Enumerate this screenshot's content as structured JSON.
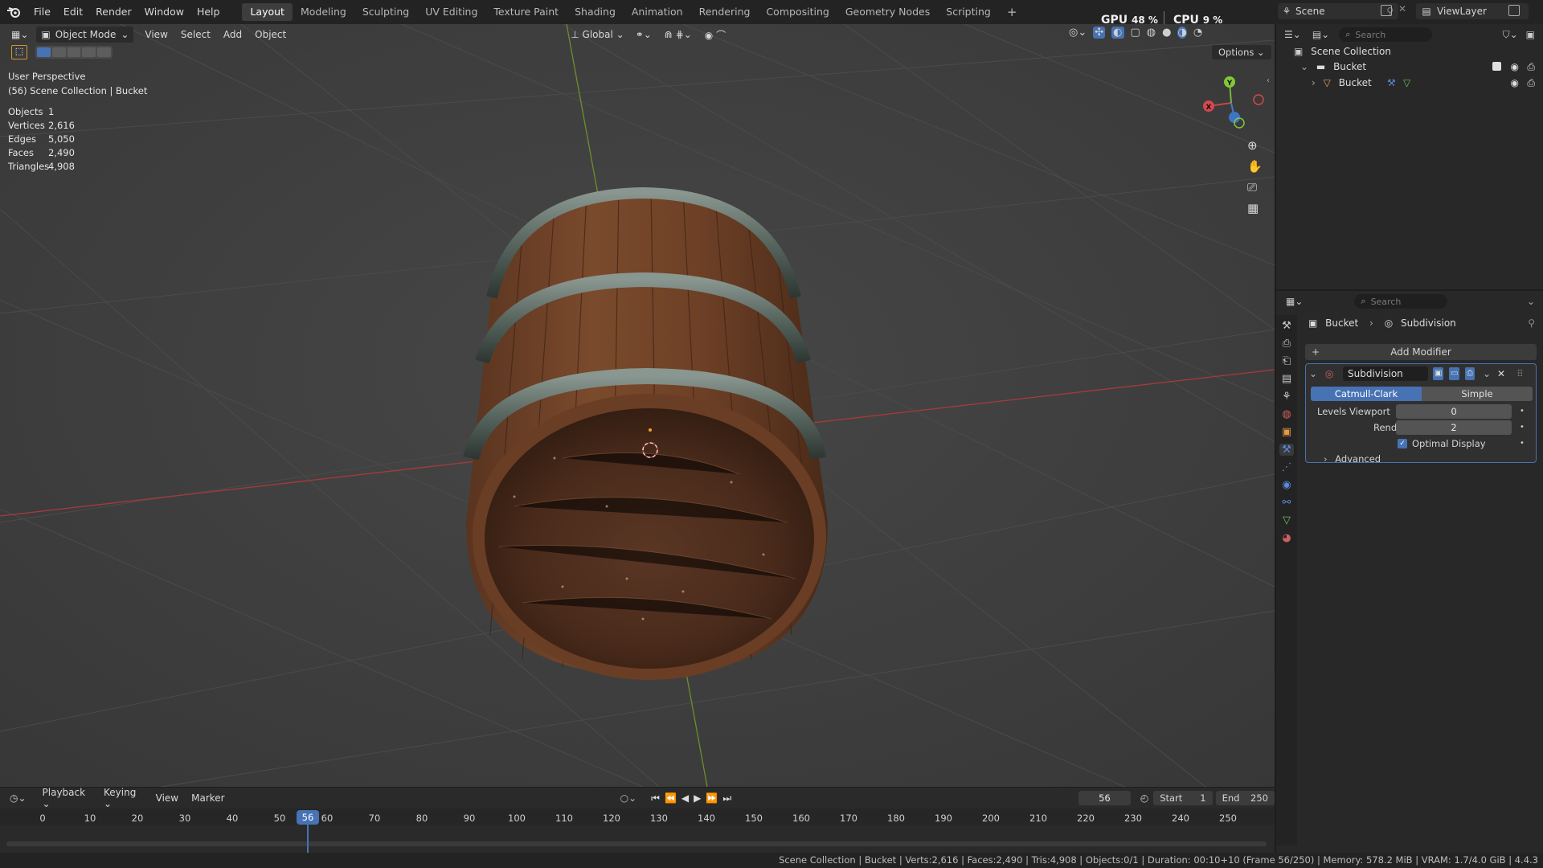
{
  "topbar": {
    "menus": [
      "File",
      "Edit",
      "Render",
      "Window",
      "Help"
    ],
    "workspaces": [
      "Layout",
      "Modeling",
      "Sculpting",
      "UV Editing",
      "Texture Paint",
      "Shading",
      "Animation",
      "Rendering",
      "Compositing",
      "Geometry Nodes",
      "Scripting"
    ],
    "active_workspace": "Layout",
    "gpu_label": "GPU",
    "gpu_value": "48 %",
    "cpu_label": "CPU",
    "cpu_value": "9 %",
    "scene": "Scene",
    "view_layer": "ViewLayer"
  },
  "viewport_header": {
    "mode": "Object Mode",
    "menus": [
      "View",
      "Select",
      "Add",
      "Object"
    ],
    "transform_orientation": "Global",
    "options": "Options"
  },
  "overlay": {
    "perspective": "User Perspective",
    "collection": "(56) Scene Collection | Bucket",
    "stats": [
      {
        "label": "Objects",
        "value": "1"
      },
      {
        "label": "Vertices",
        "value": "2,616"
      },
      {
        "label": "Edges",
        "value": "5,050"
      },
      {
        "label": "Faces",
        "value": "2,490"
      },
      {
        "label": "Triangles",
        "value": "4,908"
      }
    ]
  },
  "gizmo": {
    "x": "X",
    "y": "Y"
  },
  "outliner": {
    "search_placeholder": "Search",
    "scene_collection": "Scene Collection",
    "collection": "Bucket",
    "object": "Bucket"
  },
  "properties": {
    "search_placeholder": "Search",
    "breadcrumb_object": "Bucket",
    "breadcrumb_modifier": "Subdivision",
    "add_modifier": "Add Modifier",
    "modifier_name": "Subdivision",
    "type_catmull": "Catmull-Clark",
    "type_simple": "Simple",
    "levels_viewport_label": "Levels Viewport",
    "levels_viewport_value": "0",
    "render_label": "Render",
    "render_value": "2",
    "optimal_display": "Optimal Display",
    "advanced": "Advanced"
  },
  "timeline": {
    "menus": [
      "Playback",
      "Keying",
      "View",
      "Marker"
    ],
    "current_frame": "56",
    "start_label": "Start",
    "start_value": "1",
    "end_label": "End",
    "end_value": "250",
    "ticks": [
      "0",
      "10",
      "20",
      "30",
      "40",
      "50",
      "60",
      "70",
      "80",
      "90",
      "100",
      "110",
      "120",
      "130",
      "140",
      "150",
      "160",
      "170",
      "180",
      "190",
      "200",
      "210",
      "220",
      "230",
      "240",
      "250"
    ],
    "playhead": "56"
  },
  "statusbar": {
    "text": "Scene Collection | Bucket | Verts:2,616 | Faces:2,490 | Tris:4,908 | Objects:0/1 | Duration: 00:10+10 (Frame 56/250) | Memory: 578.2 MiB | VRAM: 1.7/4.0 GiB | 4.4.3"
  }
}
